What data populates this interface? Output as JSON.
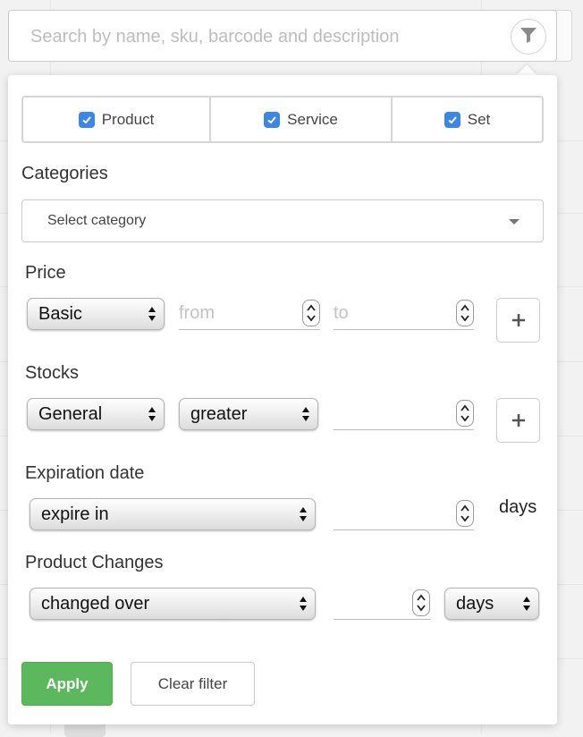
{
  "search": {
    "placeholder": "Search by name, sku, barcode and description",
    "filter_icon": "filter-icon"
  },
  "types": [
    {
      "label": "Product",
      "checked": true
    },
    {
      "label": "Service",
      "checked": true
    },
    {
      "label": "Set",
      "checked": true
    }
  ],
  "categories": {
    "label": "Categories",
    "placeholder": "Select category"
  },
  "price": {
    "label": "Price",
    "type_value": "Basic",
    "from_placeholder": "from",
    "to_placeholder": "to",
    "add_icon": "plus-icon"
  },
  "stocks": {
    "label": "Stocks",
    "scope_value": "General",
    "comparator_value": "greater",
    "add_icon": "plus-icon"
  },
  "expiration": {
    "label": "Expiration date",
    "mode_value": "expire in",
    "unit_label": "days"
  },
  "changes": {
    "label": "Product Changes",
    "mode_value": "changed over",
    "unit_value": "days"
  },
  "actions": {
    "apply_label": "Apply",
    "clear_label": "Clear filter"
  },
  "colors": {
    "checkbox": "#3c86e8",
    "apply": "#5cb85c"
  }
}
